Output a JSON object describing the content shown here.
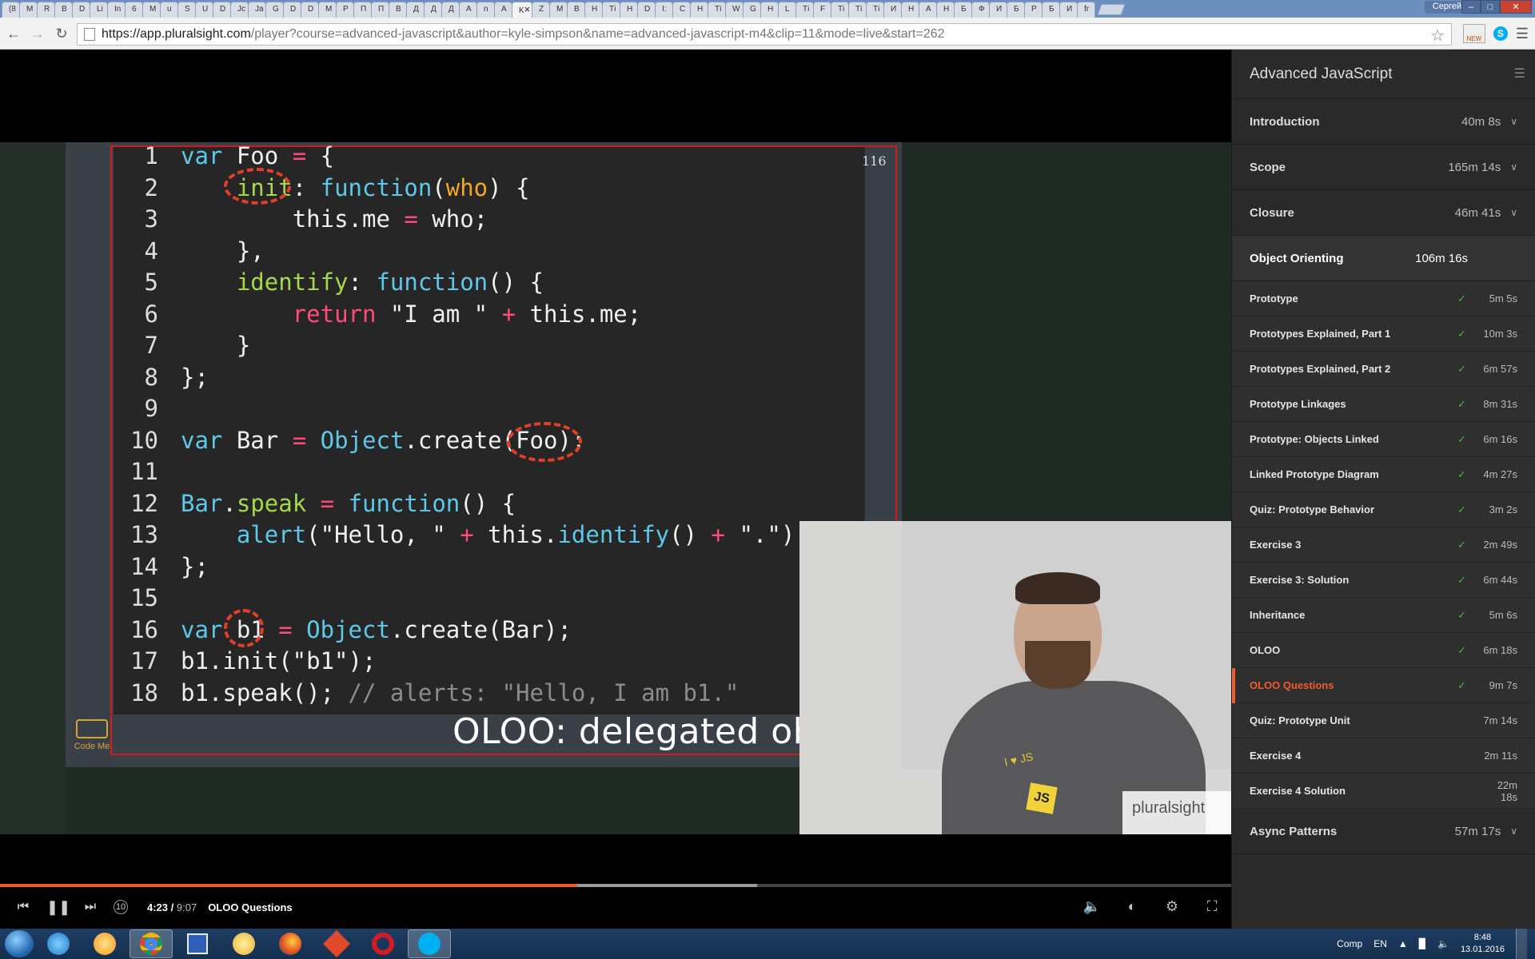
{
  "browser": {
    "tab_labels": [
      "(8",
      "M",
      "R",
      "B",
      "D",
      "Li",
      "In",
      "6",
      "M",
      "u",
      "S",
      "U",
      "D",
      "Jc",
      "Ja",
      "G",
      "D",
      "D",
      "M",
      "P",
      "П",
      "П",
      "B",
      "Д",
      "Д",
      "Д",
      "A",
      "n",
      "A",
      "K",
      "Z",
      "M",
      "B",
      "H",
      "Ті",
      "H",
      "D",
      "I:",
      "C",
      "H",
      "Ті",
      "W",
      "G",
      "H",
      "L",
      "Ті",
      "F",
      "Ті",
      "Ті",
      "Ті",
      "И",
      "H",
      "A",
      "H",
      "Б",
      "Ф",
      "И",
      "Б",
      "P",
      "Б",
      "И",
      "fr"
    ],
    "active_tab_index": 29,
    "active_tab_close": "×",
    "profile_name": "Сергей",
    "url_host": "https://app.pluralsight.com",
    "url_path": "/player?course=advanced-javascript&author=kyle-simpson&name=advanced-javascript-m4&clip=11&mode=live&start=262",
    "ext_new_label": "NEW",
    "skype_label": "S"
  },
  "slide": {
    "slide_number": "116",
    "caption": "OLOO: delegated objects",
    "logo_text": "Code Me",
    "code_lines": [
      {
        "n": "1"
      },
      {
        "n": "2"
      },
      {
        "n": "3"
      },
      {
        "n": "4"
      },
      {
        "n": "5"
      },
      {
        "n": "6"
      },
      {
        "n": "7"
      },
      {
        "n": "8"
      },
      {
        "n": "9"
      },
      {
        "n": "10"
      },
      {
        "n": "11"
      },
      {
        "n": "12"
      },
      {
        "n": "13"
      },
      {
        "n": "14"
      },
      {
        "n": "15"
      },
      {
        "n": "16"
      },
      {
        "n": "17"
      },
      {
        "n": "18"
      }
    ],
    "code": {
      "l1": [
        "var",
        " Foo ",
        "=",
        " {"
      ],
      "l2": [
        "init",
        ": ",
        "function",
        "(",
        "who",
        ") {"
      ],
      "l3": [
        "this.me ",
        "=",
        " who;"
      ],
      "l4": [
        "},"
      ],
      "l5": [
        "identify",
        ": ",
        "function",
        "() {"
      ],
      "l6": [
        "return",
        " \"I am \" ",
        "+",
        " this.me;"
      ],
      "l7": [
        "}"
      ],
      "l8": [
        "};"
      ],
      "l10": [
        "var",
        " Bar ",
        "=",
        " ",
        "Object",
        ".create(Foo);"
      ],
      "l12": [
        "Bar",
        ".",
        "speak",
        " ",
        "=",
        " ",
        "function",
        "() {"
      ],
      "l13": [
        "alert",
        "(\"Hello, \" ",
        "+",
        " this.",
        "identify",
        "() ",
        "+",
        " \".\");"
      ],
      "l14": [
        "};"
      ],
      "l16": [
        "var",
        " b1 ",
        "=",
        " ",
        "Object",
        ".create(Bar);"
      ],
      "l17": [
        "b1.init(\"b1\");"
      ],
      "l18": [
        "b1.speak(); ",
        "// alerts: \"Hello, I am b1.\""
      ]
    }
  },
  "presenter": {
    "tshirt_text": "I ♥ JS",
    "badge": "JS",
    "watermark": "pluralsight"
  },
  "player": {
    "progress_fraction": 0.469,
    "buffered_fraction": 0.615,
    "current_time": "4:23 /",
    "duration": "9:07",
    "clip_title": "OLOO Questions",
    "rewind_label": "10"
  },
  "sidebar": {
    "course_title": "Advanced JavaScript",
    "modules_before": [
      {
        "title": "Introduction",
        "duration": "40m 8s"
      },
      {
        "title": "Scope",
        "duration": "165m 14s"
      },
      {
        "title": "Closure",
        "duration": "46m 41s"
      }
    ],
    "open_module": {
      "title": "Object Orienting",
      "duration": "106m 16s"
    },
    "clips": [
      {
        "title": "Prototype",
        "duration": "5m 5s",
        "watched": true
      },
      {
        "title": "Prototypes Explained, Part 1",
        "duration": "10m 3s",
        "watched": true
      },
      {
        "title": "Prototypes Explained, Part 2",
        "duration": "6m 57s",
        "watched": true
      },
      {
        "title": "Prototype Linkages",
        "duration": "8m 31s",
        "watched": true
      },
      {
        "title": "Prototype: Objects Linked",
        "duration": "6m 16s",
        "watched": true
      },
      {
        "title": "Linked Prototype Diagram",
        "duration": "4m 27s",
        "watched": true
      },
      {
        "title": "Quiz: Prototype Behavior",
        "duration": "3m 2s",
        "watched": true
      },
      {
        "title": "Exercise 3",
        "duration": "2m 49s",
        "watched": true
      },
      {
        "title": "Exercise 3: Solution",
        "duration": "6m 44s",
        "watched": true
      },
      {
        "title": "Inheritance",
        "duration": "5m 6s",
        "watched": true
      },
      {
        "title": "OLOO",
        "duration": "6m 18s",
        "watched": true
      },
      {
        "title": "OLOO Questions",
        "duration": "9m 7s",
        "watched": true
      },
      {
        "title": "Quiz: Prototype Unit",
        "duration": "7m 14s",
        "watched": false
      },
      {
        "title": "Exercise 4",
        "duration": "2m 11s",
        "watched": false
      },
      {
        "title": "Exercise 4 Solution",
        "duration": "22m 18s",
        "watched": false
      }
    ],
    "current_clip_index": 11,
    "modules_after": [
      {
        "title": "Async Patterns",
        "duration": "57m 17s"
      }
    ]
  },
  "taskbar": {
    "tray_label": "Comp",
    "lang": "EN",
    "time": "8:48",
    "date": "13.01.2016"
  },
  "colors": {
    "accent": "#f15b2a",
    "check": "#4caf50",
    "annotation": "#e0402a"
  }
}
